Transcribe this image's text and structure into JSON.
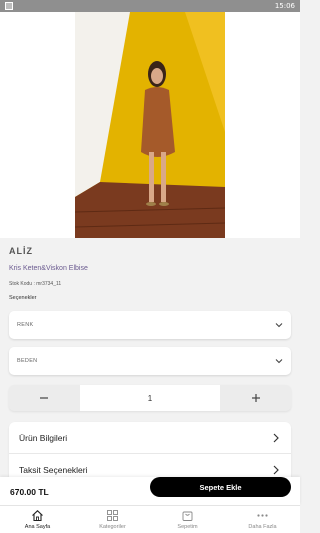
{
  "status_bar": {
    "time": "15:06"
  },
  "product": {
    "brand": "ALİZ",
    "name": "Kris Keten&Viskon Elbise",
    "stock_code": "Stok Kodu : mr3734_11",
    "price": "670.00 TL"
  },
  "options": {
    "label": "Seçenekler",
    "color_select": "RENK",
    "size_select": "BEDEN"
  },
  "quantity": {
    "value": "1"
  },
  "accordion": {
    "items": [
      "Ürün Bilgileri",
      "Taksit Seçenekleri"
    ]
  },
  "cart": {
    "add_label": "Sepete Ekle"
  },
  "tabbar": {
    "items": [
      {
        "label": "Ana Sayfa",
        "icon": "home-icon"
      },
      {
        "label": "Kategoriler",
        "icon": "grid-icon"
      },
      {
        "label": "Sepetim",
        "icon": "bag-icon"
      },
      {
        "label": "Daha Fazla",
        "icon": "more-icon"
      }
    ]
  },
  "colors": {
    "accent": "#000000",
    "wall_yellow": "#e6b400",
    "dress_brown": "#a55a2a"
  }
}
